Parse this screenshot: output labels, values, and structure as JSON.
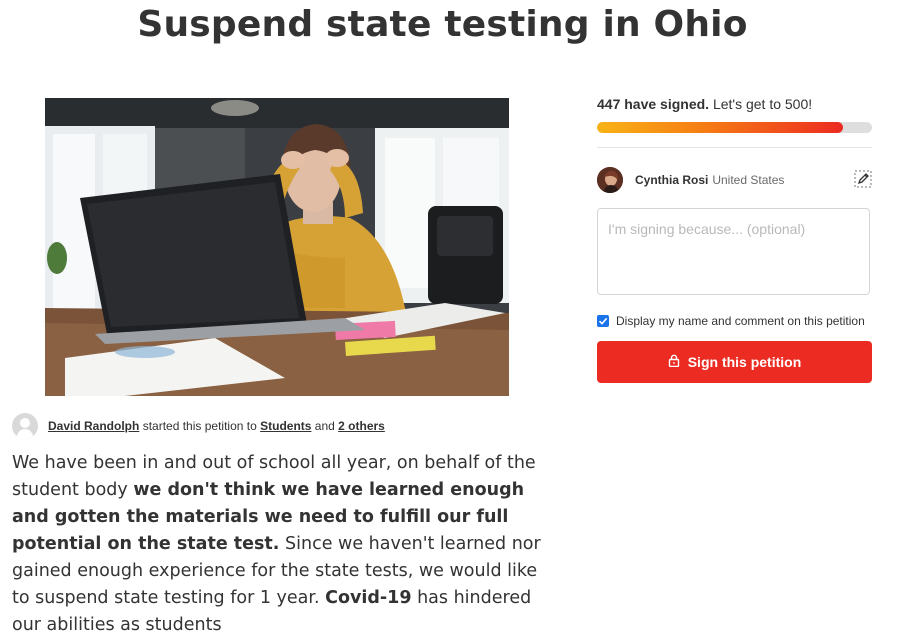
{
  "page": {
    "title": "Suspend state testing in Ohio"
  },
  "petition": {
    "starter_name": "David Randolph",
    "started_text": "started this petition to",
    "target": "Students",
    "and_text": "and",
    "others": "2 others",
    "body": {
      "p1": "We have been in and out of school all year, on behalf of the student body ",
      "b1": "we don't think we have learned enough and gotten the materials we need to fulfill our full potential on the state test.",
      "p2": " Since we haven't learned nor gained enough experience for the state tests, we would like to suspend state testing for 1 year. ",
      "b2": "Covid-19",
      "p3": " has hindered our abilities as students"
    }
  },
  "signatures": {
    "count_text": "447 have signed.",
    "goal_text": "Let's get to 500!",
    "signed": 447,
    "goal": 500
  },
  "signer": {
    "name": "Cynthia Rosi",
    "country": "United States"
  },
  "form": {
    "comment_placeholder": "I'm signing because... (optional)",
    "display_checkbox_label": "Display my name and comment on this petition",
    "display_checked": true,
    "sign_button": "Sign this petition"
  },
  "icons": {
    "edit": "edit-pencil-icon",
    "lock": "lock-icon",
    "user": "user-silhouette-icon"
  },
  "colors": {
    "accent": "#ec2c22",
    "progress_start": "#f8b315",
    "progress_end": "#ec2b21",
    "checkbox": "#1a73e8"
  }
}
